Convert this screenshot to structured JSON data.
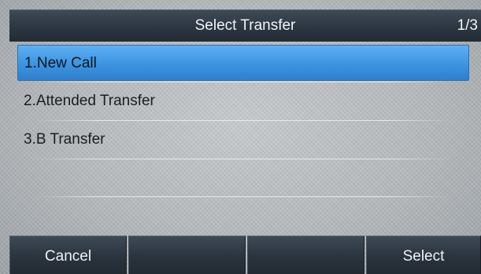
{
  "header": {
    "title": "Select Transfer",
    "page_indicator": "1/3"
  },
  "menu": {
    "items": [
      {
        "label": "1.New Call",
        "selected": true
      },
      {
        "label": "2.Attended Transfer",
        "selected": false
      },
      {
        "label": "3.B Transfer",
        "selected": false
      }
    ]
  },
  "softkeys": {
    "key1": "Cancel",
    "key2": "",
    "key3": "",
    "key4": "Select"
  },
  "colors": {
    "highlight": "#3d93e0",
    "titlebar": "#2b3540",
    "background": "#b6babd"
  }
}
